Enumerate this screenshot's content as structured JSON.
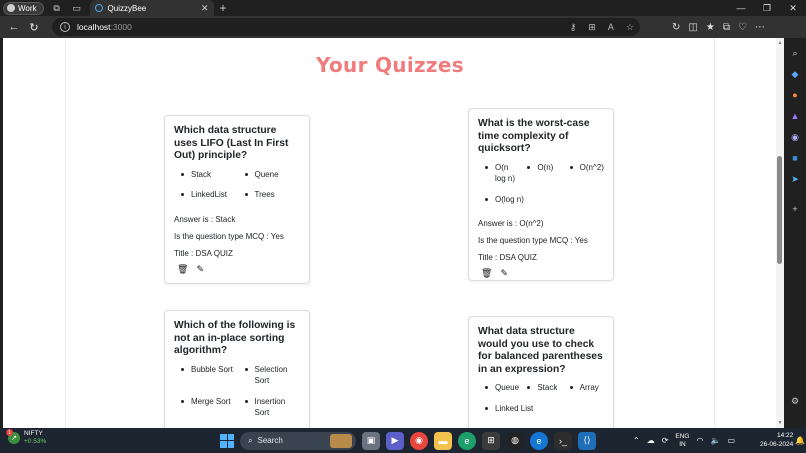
{
  "browser": {
    "profile_label": "Work",
    "tab_title": "QuizzyBee",
    "url_host": "localhost",
    "url_port": ":3000"
  },
  "page": {
    "title": "Your Quizzes"
  },
  "quizzes": [
    {
      "question": "Which data structure uses LIFO (Last In First Out) principle?",
      "options": [
        "Stack",
        "Quene",
        "LinkedList",
        "Trees"
      ],
      "answer": "Answer is : Stack",
      "mcq": "Is the question type MCQ : Yes",
      "title": "Title : DSA QUIZ"
    },
    {
      "question": "What is the worst-case time complexity of quicksort?",
      "options": [
        "O(n log n)",
        "O(n)",
        "O(n^2)",
        "O(log n)"
      ],
      "answer": "Answer is : O(n^2)",
      "mcq": "Is the question type MCQ : Yes",
      "title": "Title : DSA QUIZ"
    },
    {
      "question": "Which of the following is not an in-place sorting algorithm?",
      "options": [
        "Bubble Sort",
        "Selection Sort",
        "Merge Sort",
        "Insertion Sort"
      ]
    },
    {
      "question": "What data structure would you use to check for balanced parentheses in an expression?",
      "options": [
        "Queue",
        "Stack",
        "Array",
        "Linked List"
      ]
    }
  ],
  "icons": {
    "delete": "trash-icon",
    "edit": "edit-icon"
  },
  "taskbar": {
    "widget_name": "NIFTY",
    "widget_change": "+0.53%",
    "widget_badge": "1",
    "search_placeholder": "Search",
    "lang_line1": "ENG",
    "lang_line2": "IN",
    "time": "14:22",
    "date": "26-06-2024"
  },
  "colors": {
    "title": "#f07d7d",
    "browser_chrome": "#202020",
    "taskbar": "#1c2530"
  }
}
